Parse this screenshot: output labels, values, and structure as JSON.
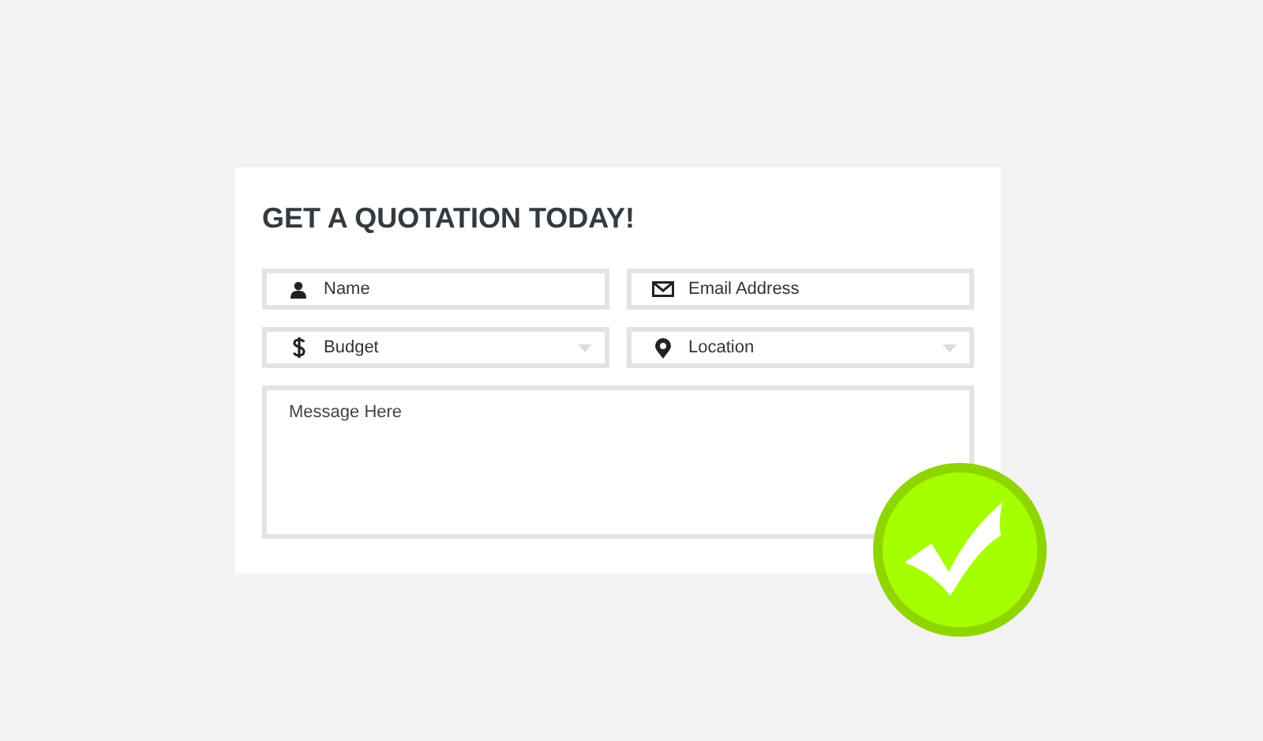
{
  "form": {
    "title": "GET A QUOTATION TODAY!",
    "fields": [
      {
        "kind": "text",
        "placeholder": "Name"
      },
      {
        "kind": "text",
        "placeholder": "Email Address"
      },
      {
        "kind": "select",
        "placeholder": "Budget"
      },
      {
        "kind": "select",
        "placeholder": "Location"
      }
    ],
    "message": {
      "placeholder": "Message Here"
    }
  }
}
